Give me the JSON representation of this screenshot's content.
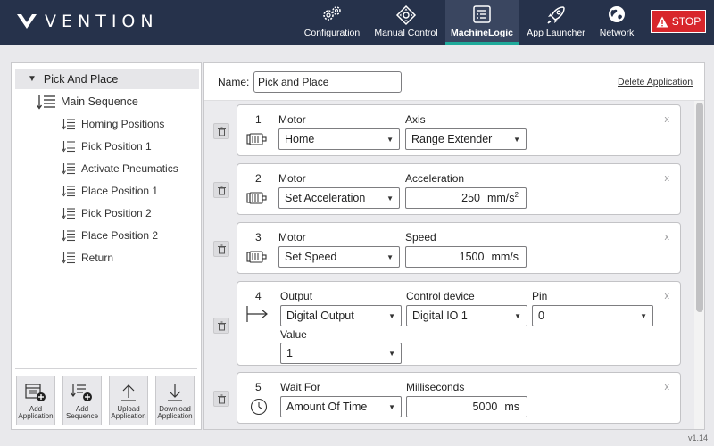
{
  "header": {
    "logo_text": "VENTION",
    "nav": [
      {
        "label": "Configuration",
        "icon": "gears-icon"
      },
      {
        "label": "Manual Control",
        "icon": "joystick-icon"
      },
      {
        "label": "MachineLogic",
        "icon": "logic-icon",
        "active": true
      },
      {
        "label": "App Launcher",
        "icon": "rocket-icon"
      },
      {
        "label": "Network",
        "icon": "globe-icon"
      }
    ],
    "stop_label": "STOP",
    "colors": {
      "bar": "#26324b",
      "active_underline": "#1faa9a",
      "stop": "#d8262b"
    }
  },
  "tree": {
    "root": "Pick And Place",
    "main_sequence": "Main Sequence",
    "items": [
      "Homing Positions",
      "Pick Position 1",
      "Activate Pneumatics",
      "Place Position 1",
      "Pick Position 2",
      "Place Position 2",
      "Return"
    ]
  },
  "toolbar": [
    {
      "label": "Add\nApplication",
      "icon": "add-application-icon"
    },
    {
      "label": "Add\nSequence",
      "icon": "add-sequence-icon"
    },
    {
      "label": "Upload\nApplication",
      "icon": "upload-icon"
    },
    {
      "label": "Download\nApplication",
      "icon": "download-icon"
    }
  ],
  "editor": {
    "name_label": "Name:",
    "name_value": "Pick and Place",
    "delete_label": "Delete Application"
  },
  "steps": [
    {
      "num": "1",
      "type": "Motor",
      "f1_label": "Motor",
      "f1_value": "Home",
      "f2_label": "Axis",
      "f2_value": "Range Extender",
      "close": "x"
    },
    {
      "num": "2",
      "type": "Motor",
      "f1_label": "Motor",
      "f1_value": "Set Acceleration",
      "f2_label": "Acceleration",
      "f2_value": "250",
      "f2_unit": "mm/s",
      "f2_sup": "2",
      "close": "x"
    },
    {
      "num": "3",
      "type": "Motor",
      "f1_label": "Motor",
      "f1_value": "Set Speed",
      "f2_label": "Speed",
      "f2_value": "1500",
      "f2_unit": "mm/s",
      "close": "x"
    },
    {
      "num": "4",
      "type": "Output",
      "f1_label": "Output",
      "f1_value": "Digital Output",
      "f2_label": "Control device",
      "f2_value": "Digital IO 1",
      "f3_label": "Pin",
      "f3_value": "0",
      "f4_label": "Value",
      "f4_value": "1",
      "close": "x"
    },
    {
      "num": "5",
      "type": "Wait",
      "f1_label": "Wait For",
      "f1_value": "Amount Of Time",
      "f2_label": "Milliseconds",
      "f2_value": "5000",
      "f2_unit": "ms",
      "close": "x"
    }
  ],
  "version": "v1.14"
}
